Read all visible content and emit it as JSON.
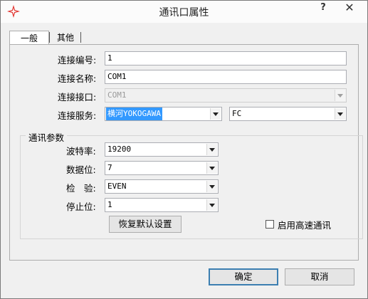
{
  "window": {
    "title": "通讯口属性",
    "help": "?",
    "close": "✕"
  },
  "tabs": [
    {
      "label": "一般"
    },
    {
      "label": "其他"
    }
  ],
  "general": {
    "conn_no": {
      "label": "连接编号:",
      "value": "1"
    },
    "conn_name": {
      "label": "连接名称:",
      "value": "COM1"
    },
    "conn_port": {
      "label": "连接接口:",
      "value": "COM1"
    },
    "conn_service": {
      "label": "连接服务:",
      "value": "横河YOKOGAWA",
      "protocol": "FC"
    }
  },
  "comm": {
    "group_title": "通讯参数",
    "baud": {
      "label": "波特率:",
      "value": "19200"
    },
    "data_bits": {
      "label": "数据位:",
      "value": "7"
    },
    "parity": {
      "label": "检　验:",
      "value": "EVEN"
    },
    "stop_bits": {
      "label": "停止位:",
      "value": "1"
    },
    "restore_label": "恢复默认设置",
    "highspeed_label": "启用高速通讯",
    "highspeed_checked": false
  },
  "footer": {
    "ok": "确定",
    "cancel": "取消"
  },
  "colors": {
    "accent": "#3399ff",
    "default_border": "#3c7fb1",
    "icon": "#e0302b"
  },
  "icons": {
    "app": "red-compass-star-icon"
  }
}
